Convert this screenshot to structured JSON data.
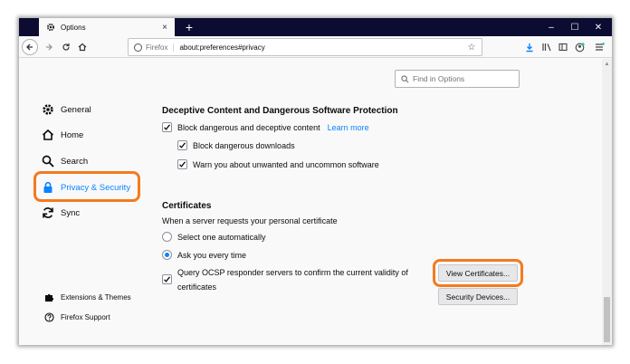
{
  "tab": {
    "title": "Options",
    "close": "×",
    "new": "+"
  },
  "window_controls": {
    "minimize": "–",
    "maximize": "☐",
    "close": "✕"
  },
  "navbar": {
    "identity": "Firefox",
    "url": "about:preferences#privacy",
    "star": "☆"
  },
  "search": {
    "placeholder": "Find in Options"
  },
  "sidebar": {
    "items": [
      {
        "label": "General",
        "icon": "gear-icon"
      },
      {
        "label": "Home",
        "icon": "home-icon"
      },
      {
        "label": "Search",
        "icon": "search-icon"
      },
      {
        "label": "Privacy & Security",
        "icon": "lock-icon",
        "active": true
      },
      {
        "label": "Sync",
        "icon": "sync-icon"
      }
    ],
    "footer": [
      {
        "label": "Extensions & Themes",
        "icon": "puzzle-icon"
      },
      {
        "label": "Firefox Support",
        "icon": "help-icon"
      }
    ]
  },
  "deceptive": {
    "title": "Deceptive Content and Dangerous Software Protection",
    "block_content": "Block dangerous and deceptive content",
    "learn_more": "Learn more",
    "block_downloads": "Block dangerous downloads",
    "warn_unwanted": "Warn you about unwanted and uncommon software"
  },
  "certificates": {
    "title": "Certificates",
    "prompt": "When a server requests your personal certificate",
    "select_auto": "Select one automatically",
    "ask_every": "Ask you every time",
    "ocsp_line1": "Query OCSP responder servers to confirm the current validity of",
    "ocsp_line2": "certificates",
    "view_button": "View Certificates...",
    "devices_button": "Security Devices..."
  },
  "colors": {
    "accent": "#0a84ff",
    "highlight": "#f47a20",
    "tabstrip": "#0c0c33"
  }
}
